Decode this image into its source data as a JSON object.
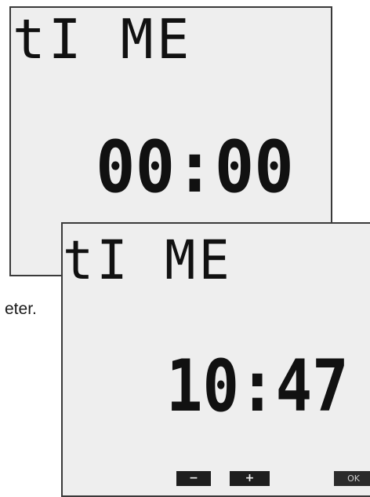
{
  "background_caption": "eter.",
  "back_screen": {
    "label": "tI ME",
    "time": "00:00"
  },
  "front_screen": {
    "label": "tI ME",
    "time": "10:47",
    "softkeys": {
      "minus": "−",
      "plus": "+",
      "ok": "OK"
    }
  },
  "colors": {
    "lcd_background": "#eeeeee",
    "lcd_border": "#3a3a3a",
    "segment_ink": "#111111",
    "softkey_background": "#1e1e1e",
    "softkey_text": "#f2f2f2"
  }
}
